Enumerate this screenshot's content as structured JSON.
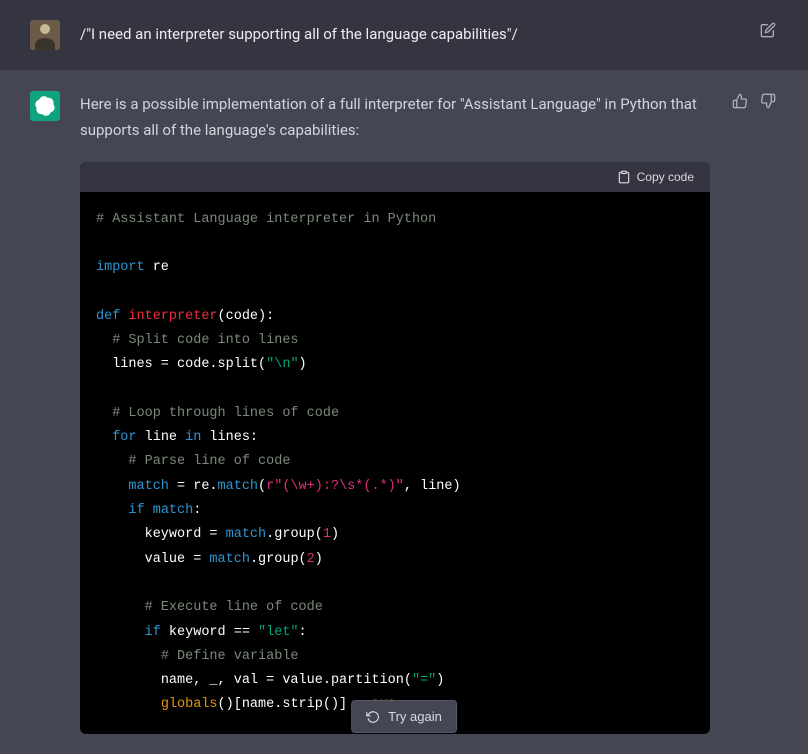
{
  "user": {
    "message": "/\"I need an interpreter supporting all of the language capabilities\"/"
  },
  "assistant": {
    "intro": "Here is a possible implementation of a full interpreter for \"Assistant Language\" in Python that supports all of the language's capabilities:",
    "copy_label": "Copy code",
    "code": {
      "c1": "# Assistant Language interpreter in Python",
      "l2a": "import",
      "l2b": " re",
      "l3a": "def ",
      "l3b": "interpreter",
      "l3c": "(code):",
      "c4": "# Split code into lines",
      "l5a": "lines = code.split(",
      "l5b": "\"\\n\"",
      "l5c": ")",
      "c6": "# Loop through lines of code",
      "l7a": "for",
      "l7b": " line ",
      "l7c": "in",
      "l7d": " lines:",
      "c8": "# Parse line of code",
      "l9a": "match",
      "l9b": " = re.",
      "l9c": "match",
      "l9d": "(",
      "l9e": "r\"(\\w+):?\\s*(.*)\"",
      "l9f": ", line)",
      "l10a": "if",
      "l10b": " ",
      "l10c": "match",
      "l10d": ":",
      "l11a": "keyword = ",
      "l11b": "match",
      "l11c": ".group(",
      "l11d": "1",
      "l11e": ")",
      "l12a": "value = ",
      "l12b": "match",
      "l12c": ".group(",
      "l12d": "2",
      "l12e": ")",
      "c13": "# Execute line of code",
      "l14a": "if",
      "l14b": " keyword == ",
      "l14c": "\"let\"",
      "l14d": ":",
      "c15": "# Define variable",
      "l16a": "name, _, val = value.partition(",
      "l16b": "\"=\"",
      "l16c": ")",
      "l17a": "globals",
      "l17b": "()[name.strip()] = ",
      "l17c": "eva"
    }
  },
  "try_again": "Try again"
}
